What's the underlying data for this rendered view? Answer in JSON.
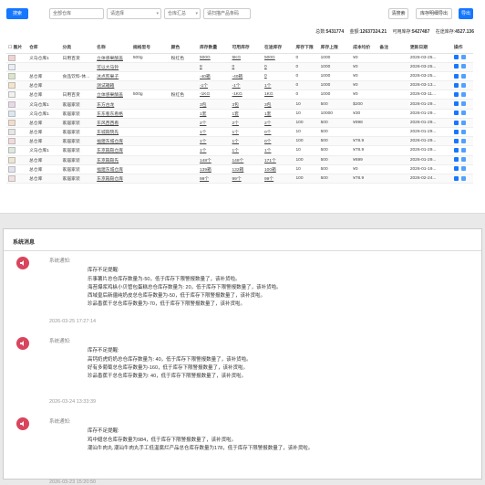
{
  "toolbar": {
    "search_btn": "搜索",
    "input1": "全部仓库",
    "input2": "请选择",
    "select3": "仓库汇总",
    "input4": "请扫描产品条码",
    "reset_btn": "清搜索",
    "export_btn": "库存明细导出",
    "export2_btn": "导出"
  },
  "summary": {
    "total_label": "总数:",
    "total": "5431774",
    "amount_label": "金额:",
    "amount": "12637324.21",
    "avail_label": "可用库存:",
    "avail": "5427487",
    "transit_label": "在途库存:",
    "transit": "4527.136"
  },
  "table": {
    "headers": [
      "图片",
      "仓库",
      "分类",
      "名称",
      "规格型号",
      "颜色",
      "库存数量",
      "可用库存",
      "在途库存",
      "库存下限",
      "库存上限",
      "成本均价",
      "备注",
      "更新日期",
      "操作"
    ],
    "rows": [
      [
        "义乌仓库1",
        "日用百货",
        "立体感果酸盖",
        "500g",
        "粉红色",
        "500G",
        "5KG",
        "500G",
        "0",
        "1000",
        "¥0",
        "",
        "2026-03-25..."
      ],
      [
        "",
        "",
        "可以大马铃",
        "",
        "",
        "8",
        "0",
        "0",
        "0",
        "1000",
        "¥0",
        "",
        "2026-03-25..."
      ],
      [
        "总仓库",
        "食品饮料-休...",
        "冰点煎果子",
        "",
        "",
        "-40箱",
        "-40箱",
        "0",
        "0",
        "1000",
        "¥0",
        "",
        "2026-03-25..."
      ],
      [
        "总仓库",
        "",
        "测试箱箱",
        "",
        "",
        "-1个",
        "-1个",
        "1个",
        "0",
        "1000",
        "¥0",
        "",
        "2026-03-13..."
      ],
      [
        "总仓库",
        "日用百货",
        "立体感果酸盖",
        "500g",
        "粉红色",
        "-1KG",
        "-1KG",
        "1KG",
        "0",
        "1000",
        "¥0",
        "",
        "2026-03-11..."
      ],
      [
        "义乌仓库1",
        "家居家装",
        "东方古龙",
        "",
        "",
        "3包",
        "3包",
        "3包",
        "10",
        "500",
        "$200",
        "",
        "2026-01-29..."
      ],
      [
        "义乌仓库1",
        "家居家装",
        "东东看东看格",
        "",
        "",
        "1套",
        "1套",
        "1套",
        "10",
        "10000",
        "¥30",
        "",
        "2026-01-29..."
      ],
      [
        "总仓库",
        "家居家装",
        "东风西西看",
        "",
        "",
        "2个",
        "2个",
        "2个",
        "100",
        "500",
        "¥998",
        "",
        "2026-01-29..."
      ],
      [
        "总仓库",
        "家居家装",
        "东城殿院先",
        "",
        "",
        "1个",
        "1个",
        "0个",
        "10",
        "500",
        "",
        "",
        "2026-01-29..."
      ],
      [
        "总仓库",
        "家居家装",
        "福建东城仓库",
        "",
        "",
        "1个",
        "1个",
        "0个",
        "100",
        "500",
        "¥78.9",
        "",
        "2026-01-29..."
      ],
      [
        "义乌仓库1",
        "家居家装",
        "东京殿殿仓库",
        "",
        "",
        "1个",
        "1个",
        "1个",
        "10",
        "500",
        "¥78.9",
        "",
        "2026-01-29..."
      ],
      [
        "总仓库",
        "家居家装",
        "东京殿殿先",
        "",
        "",
        "148个",
        "148个",
        "171个",
        "100",
        "500",
        "¥699",
        "",
        "2026-01-29..."
      ],
      [
        "总仓库",
        "家居家装",
        "福建东城仓库",
        "",
        "",
        "139箱",
        "132箱",
        "100箱",
        "10",
        "500",
        "¥0",
        "",
        "2026-01-19..."
      ],
      [
        "总仓库",
        "家居家装",
        "东京殿殿仓库",
        "",
        "",
        "99个",
        "99个",
        "99个",
        "100",
        "500",
        "¥78.9",
        "",
        "2026-02-24..."
      ]
    ]
  },
  "panel": {
    "title": "系统消息",
    "messages": [
      {
        "label": "系统通知:",
        "head": "库存不足提醒:",
        "lines": [
          "乐事薯片总仓库存数量为-50，低于库存下限警报数量了，该补货啦。",
          "海苔爆浆鸡枞小贝管包蛋糕总仓库存数量为: 20，低于库存下限警报数量了，该补货啦。",
          "西域皇后新疆纯奶皮总仓库存数量为-50，低于库存下限警报数量了，该补货啦。",
          "珍品香蕉干总仓库存数量为-70，低于库存下限警报数量了，该补货啦。"
        ],
        "time": "2026-03-25 17:27:14"
      },
      {
        "label": "系统通知:",
        "head": "库存不足提醒:",
        "lines": [
          "高钙奶虎奶奶总仓库存数量为: 40，低于库存下限警报数量了，该补货啦。",
          "好有多葡萄总仓库存数量为-160，低于库存下限警报数量了，该补货啦。",
          "珍品香蕉干总仓库存数量为: 40，低于库存下限警报数量了，该补货啦。"
        ],
        "time": "2026-03-24 13:33:39"
      },
      {
        "label": "系统通知:",
        "head": "库存不足提醒:",
        "lines": [
          "鸡中翅总仓库存数量为984，低于库存下限警报数量了，该补货啦。",
          "潮汕牛肉丸 潮汕牛肉丸手工低温腐烂产品总仓库存数量为178，低于库存下限警报数量了，该补货啦。"
        ],
        "time": "2026-03-23 15:20:50"
      }
    ]
  }
}
